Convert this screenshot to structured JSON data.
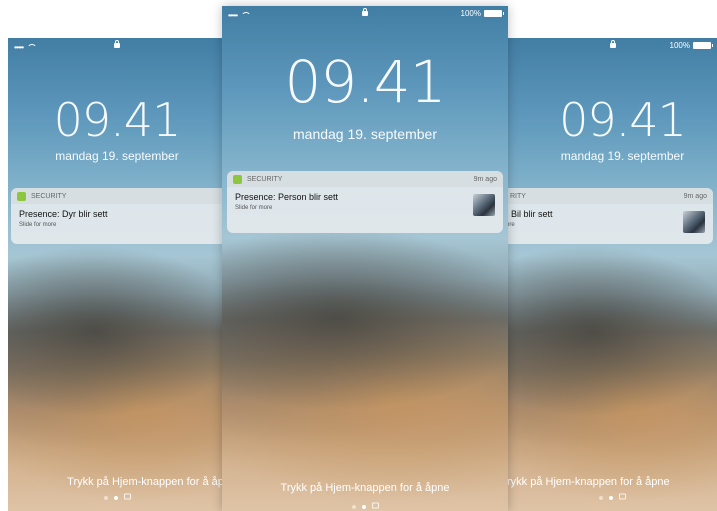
{
  "status_bar": {
    "signal": "•••••",
    "battery_percent": "100%"
  },
  "lock_screen": {
    "time": "09.41",
    "date": "mandag 19. september",
    "hint": "Trykk på Hjem-knappen for å åpne"
  },
  "screens": {
    "left": {
      "notification": {
        "app_name": "SECURITY",
        "title": "Presence: Dyr blir sett",
        "subtitle": "Slide for more"
      },
      "hint": "Trykk på Hjem-knappen for å åpn"
    },
    "center": {
      "notification": {
        "app_name": "SECURITY",
        "time": "9m ago",
        "title": "Presence: Person blir sett",
        "subtitle": "Slide for more"
      },
      "hint": "Trykk på Hjem-knappen for å åpne"
    },
    "right": {
      "notification": {
        "app_name": "RITY",
        "time": "9m ago",
        "title": ": Bil blir sett",
        "subtitle": "ore"
      },
      "hint": "rykk på Hjem-knappen for å åpne"
    }
  },
  "colors": {
    "app_icon": "#8cc63f",
    "notification_bg": "#e8ecee"
  }
}
